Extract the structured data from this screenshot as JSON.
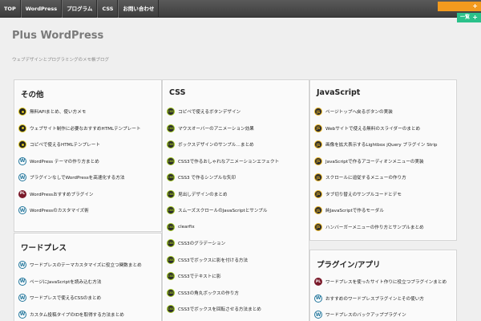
{
  "nav": [
    {
      "label": "TOP"
    },
    {
      "label": "WordPress"
    },
    {
      "label": "プログラム"
    },
    {
      "label": "CSS"
    },
    {
      "label": "お問い合わせ"
    }
  ],
  "ribbons": {
    "orange_label": "",
    "green_label": "一覧",
    "plus": "+"
  },
  "site": {
    "title": "Plus WordPress",
    "description": "ウェブデザインとプログラミングのメモ帳ブログ"
  },
  "cards": [
    {
      "title": "その他",
      "items": [
        {
          "icon": "code",
          "label": "無料APIまとめ、使い方メモ"
        },
        {
          "icon": "code",
          "label": "ウェブサイト制作に必要なおすすめHTMLテンプレート"
        },
        {
          "icon": "code",
          "label": "コピペで使えるHTMLテンプレート"
        },
        {
          "icon": "wp",
          "label": "WordPress テーマの作り方まとめ"
        },
        {
          "icon": "wp",
          "label": "プラグインなしでWordPressを高速化する方法"
        },
        {
          "icon": "pl",
          "label": "WordPressおすすめプラグイン"
        },
        {
          "icon": "wp",
          "label": "WordPressのカスタマイズ術"
        }
      ]
    },
    {
      "title": "CSS",
      "items": [
        {
          "icon": "css",
          "label": "コピペで使えるボタンデザイン"
        },
        {
          "icon": "css",
          "label": "マウスオーバーのアニメーション効果"
        },
        {
          "icon": "css",
          "label": "ボックスデザインのサンプル…まとめ"
        },
        {
          "icon": "css",
          "label": "CSS3で作るおしゃれなアニメーションエフェクト"
        },
        {
          "icon": "css",
          "label": "CSS3 で作るシンプルな矢印"
        },
        {
          "icon": "css",
          "label": "見出しデザインのまとめ"
        },
        {
          "icon": "css",
          "label": "スムーズスクロールのJavaScriptとサンプル"
        },
        {
          "icon": "css",
          "label": "clearfix"
        },
        {
          "icon": "css",
          "label": "CSS3のグラデーション"
        },
        {
          "icon": "css",
          "label": "CSS3でボックスに影を付ける方法"
        },
        {
          "icon": "css",
          "label": "CSS3でテキストに影"
        },
        {
          "icon": "css",
          "label": "CSS3の角丸ボックスの作り方"
        },
        {
          "icon": "css",
          "label": "CSS3でボックスを回転させる方法まとめ"
        }
      ]
    },
    {
      "title": "JavaScript",
      "items": [
        {
          "icon": "js",
          "label": "ページトップへ戻るボタンの実装"
        },
        {
          "icon": "js",
          "label": "Webサイトで使える無料のスライダーのまとめ"
        },
        {
          "icon": "js",
          "label": "画像を拡大表示するLightbox jQuery プラグイン Strip"
        },
        {
          "icon": "js",
          "label": "JavaScriptで作るアコーディオンメニューの実装"
        },
        {
          "icon": "js",
          "label": "スクロールに追従するメニューの作り方"
        },
        {
          "icon": "js",
          "label": "タブ切り替えのサンプルコードとデモ"
        },
        {
          "icon": "js",
          "label": "純JavaScriptで作るモーダル"
        },
        {
          "icon": "js",
          "label": "ハンバーガーメニューの作り方とサンプルまとめ"
        }
      ]
    },
    {
      "title": "ワードプレス",
      "items": [
        {
          "icon": "wp",
          "label": "ワードプレスのテーマカスタマイズに役立つ関数まとめ"
        },
        {
          "icon": "wp",
          "label": "ページにJavaScriptを読み込む方法"
        },
        {
          "icon": "wp",
          "label": "ワードプレスで使えるCSSのまとめ"
        },
        {
          "icon": "wp",
          "label": "カスタム投稿タイプのIDを取得する方法まとめ"
        }
      ]
    },
    {
      "title": "プラグイン/アプリ",
      "items": [
        {
          "icon": "pl",
          "label": "ワードプレスを使ったサイト作りに役立つプラグインまとめ"
        },
        {
          "icon": "wp",
          "label": "おすすめのワードプレスプラグインとその使い方"
        },
        {
          "icon": "wp",
          "label": "ワードプレスのバックアッププラグイン"
        }
      ]
    }
  ]
}
